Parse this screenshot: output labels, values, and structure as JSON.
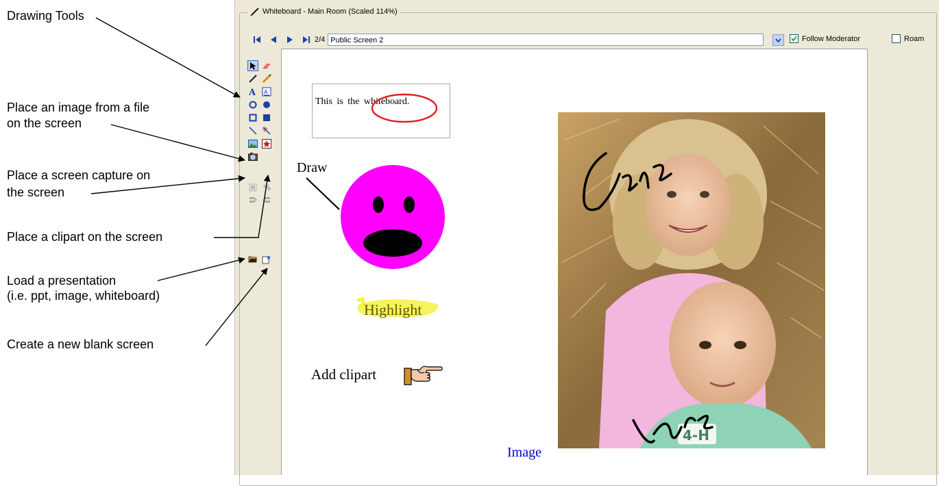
{
  "annotations": {
    "drawing_tools": "Drawing Tools",
    "place_image_line1": "Place an image from a file",
    "place_image_line2": "on the screen",
    "screen_capture_line1": "Place a screen capture on",
    "screen_capture_line2": "the screen",
    "clipart": "Place a clipart on the screen",
    "load_line1": "Load a presentation",
    "load_line2": "(i.e. ppt, image, whiteboard)",
    "new_screen": "Create a new blank screen"
  },
  "window": {
    "title": "Whiteboard - Main Room (Scaled 114%)"
  },
  "toolbar": {
    "page_indicator": "2/4",
    "screen_name": "Public Screen 2",
    "follow_moderator_label": "Follow Moderator",
    "follow_moderator_checked": true,
    "roam_label": "Roam",
    "roam_checked": false
  },
  "canvas": {
    "textbox_prefix": "This is the",
    "textbox_circled": "whiteboard.",
    "draw_label": "Draw",
    "highlight_label": "Highlight",
    "add_clipart_label": "Add clipart",
    "image_label": "Image",
    "handwriting_1": "Jane",
    "handwriting_2": "Lars"
  },
  "colors": {
    "smiley_face": "#ff00ff",
    "highlight": "#f6f24a",
    "circle_stroke": "#e02020",
    "image_label": "#0000cc",
    "window_bg": "#ece9d8"
  },
  "icons": {
    "nav": [
      "first-page-icon",
      "prev-page-icon",
      "next-page-icon",
      "last-page-icon"
    ],
    "tools": [
      "select-arrow-icon",
      "eraser-icon",
      "pen-icon",
      "highlighter-icon",
      "text-icon",
      "text-block-icon",
      "circle-outline-icon",
      "circle-filled-icon",
      "rectangle-outline-icon",
      "rectangle-filled-icon",
      "line-icon",
      "magic-wand-icon",
      "place-image-icon",
      "clipart-icon",
      "screen-capture-icon",
      "group-icon",
      "scale-icon",
      "bring-front-icon",
      "send-back-icon",
      "open-folder-icon",
      "new-screen-icon"
    ]
  }
}
